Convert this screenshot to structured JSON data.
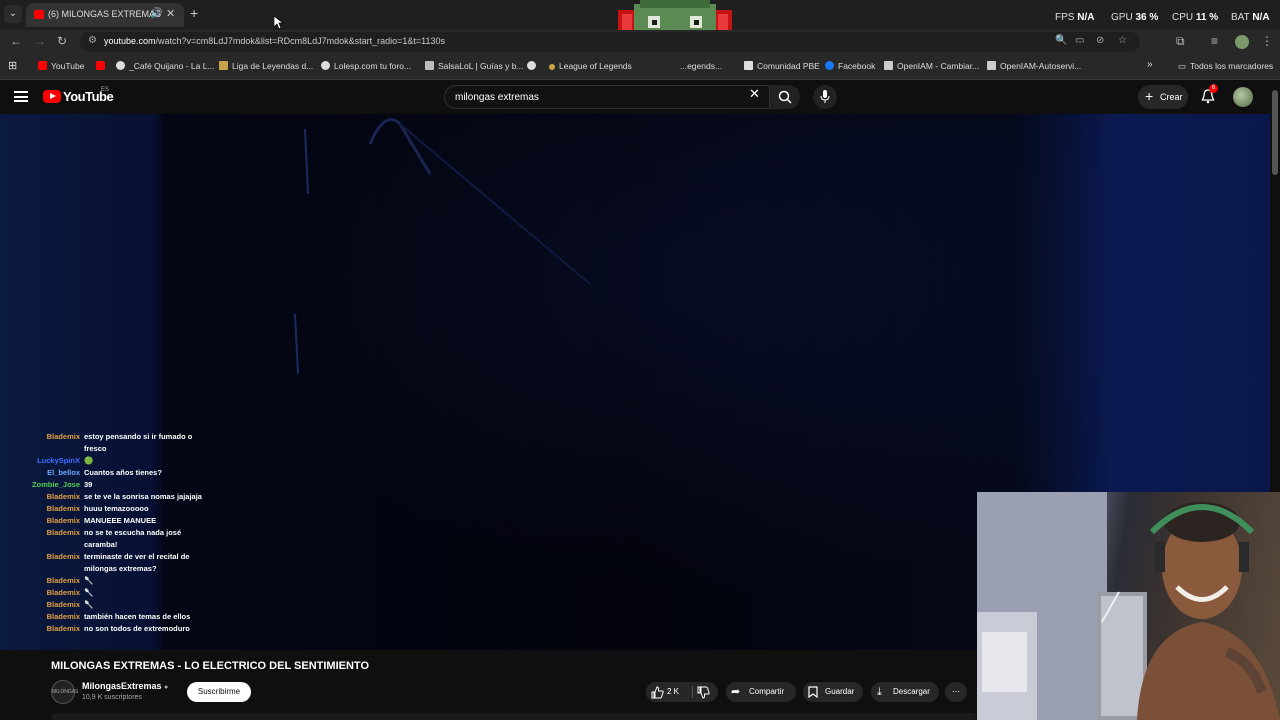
{
  "browser": {
    "tab_title": "(6) MILONGAS EXTREMAS",
    "url_host": "youtube.com",
    "url_path": "/watch?v=cm8LdJ7mdok&list=RDcm8LdJ7mdok&start_radio=1&t=1130s",
    "bookmarks": [
      {
        "label": "YouTube",
        "icon": "youtube-icon"
      },
      {
        "label": "",
        "icon": "youtube-icon"
      },
      {
        "label": "_Café Quijano - La L...",
        "icon": "globe-icon"
      },
      {
        "label": "Liga de Leyendas d...",
        "icon": "league-icon"
      },
      {
        "label": "Lolesp.com tu foro...",
        "icon": "globe-icon"
      },
      {
        "label": "SalsaLoL | Guías y b...",
        "icon": "salsa-icon"
      },
      {
        "label": "",
        "icon": "globe-icon"
      },
      {
        "label": "League of Legends",
        "icon": "league-icon"
      },
      {
        "label": "...egends...",
        "icon": "league-icon"
      },
      {
        "label": "Comunidad PBE",
        "icon": "pbe-icon"
      },
      {
        "label": "Facebook",
        "icon": "facebook-icon"
      },
      {
        "label": "OpenIAM - Cambiar...",
        "icon": "openiam-icon"
      },
      {
        "label": "OpenIAM-Autoservi...",
        "icon": "openiam-icon"
      }
    ],
    "all_bookmarks_label": "Todos los marcadores"
  },
  "hud": {
    "fps_label": "FPS",
    "fps_value": "N/A",
    "gpu_label": "GPU",
    "gpu_value": "36 %",
    "cpu_label": "CPU",
    "cpu_value": "11 %",
    "bat_label": "BAT",
    "bat_value": "N/A"
  },
  "youtube": {
    "logo_text": "YouTube",
    "country_code": "ES",
    "search_query": "milongas extremas",
    "create_label": "Crear",
    "notifications_count": "6"
  },
  "chat": [
    {
      "user": "Blademix",
      "text": "estoy pensando si ir fumado o fresco",
      "color": "#e0a040"
    },
    {
      "user": "LuckySpinX",
      "text": "🟢",
      "color": "#3b6fff"
    },
    {
      "user": "El_bellox",
      "text": "Cuantos años tienes?",
      "color": "#6aa9ff"
    },
    {
      "user": "Zombie_Jose",
      "text": "39",
      "color": "#4fd04f"
    },
    {
      "user": "Blademix",
      "text": "se te ve la sonrisa nomas jajajaja",
      "color": "#e0a040"
    },
    {
      "user": "Blademix",
      "text": "huuu temazooooo",
      "color": "#e0a040"
    },
    {
      "user": "Blademix",
      "text": "MANUEEE MANUEE",
      "color": "#e0a040"
    },
    {
      "user": "Blademix",
      "text": "no se te escucha nada josé caramba!",
      "color": "#e0a040"
    },
    {
      "user": "Blademix",
      "text": "terminaste de ver el recital de milongas extremas?",
      "color": "#e0a040"
    },
    {
      "user": "Blademix",
      "text": "🥄",
      "color": "#e0a040"
    },
    {
      "user": "Blademix",
      "text": "🥄",
      "color": "#e0a040"
    },
    {
      "user": "Blademix",
      "text": "🥄",
      "color": "#e0a040"
    },
    {
      "user": "Blademix",
      "text": "también hacen temas de ellos",
      "color": "#e0a040"
    },
    {
      "user": "Blademix",
      "text": "no son todos de extremoduro",
      "color": "#e0a040"
    }
  ],
  "video": {
    "title": "MILONGAS EXTREMAS - LO ELECTRICO DEL SENTIMIENTO",
    "channel_name": "MilongasExtremas",
    "channel_avatar_text": "MILONGAS",
    "subscribers": "10,9 K suscriptores",
    "subscribe_label": "Suscribirme",
    "likes": "2 K",
    "share_label": "Compartir",
    "save_label": "Guardar",
    "download_label": "Descargar"
  }
}
